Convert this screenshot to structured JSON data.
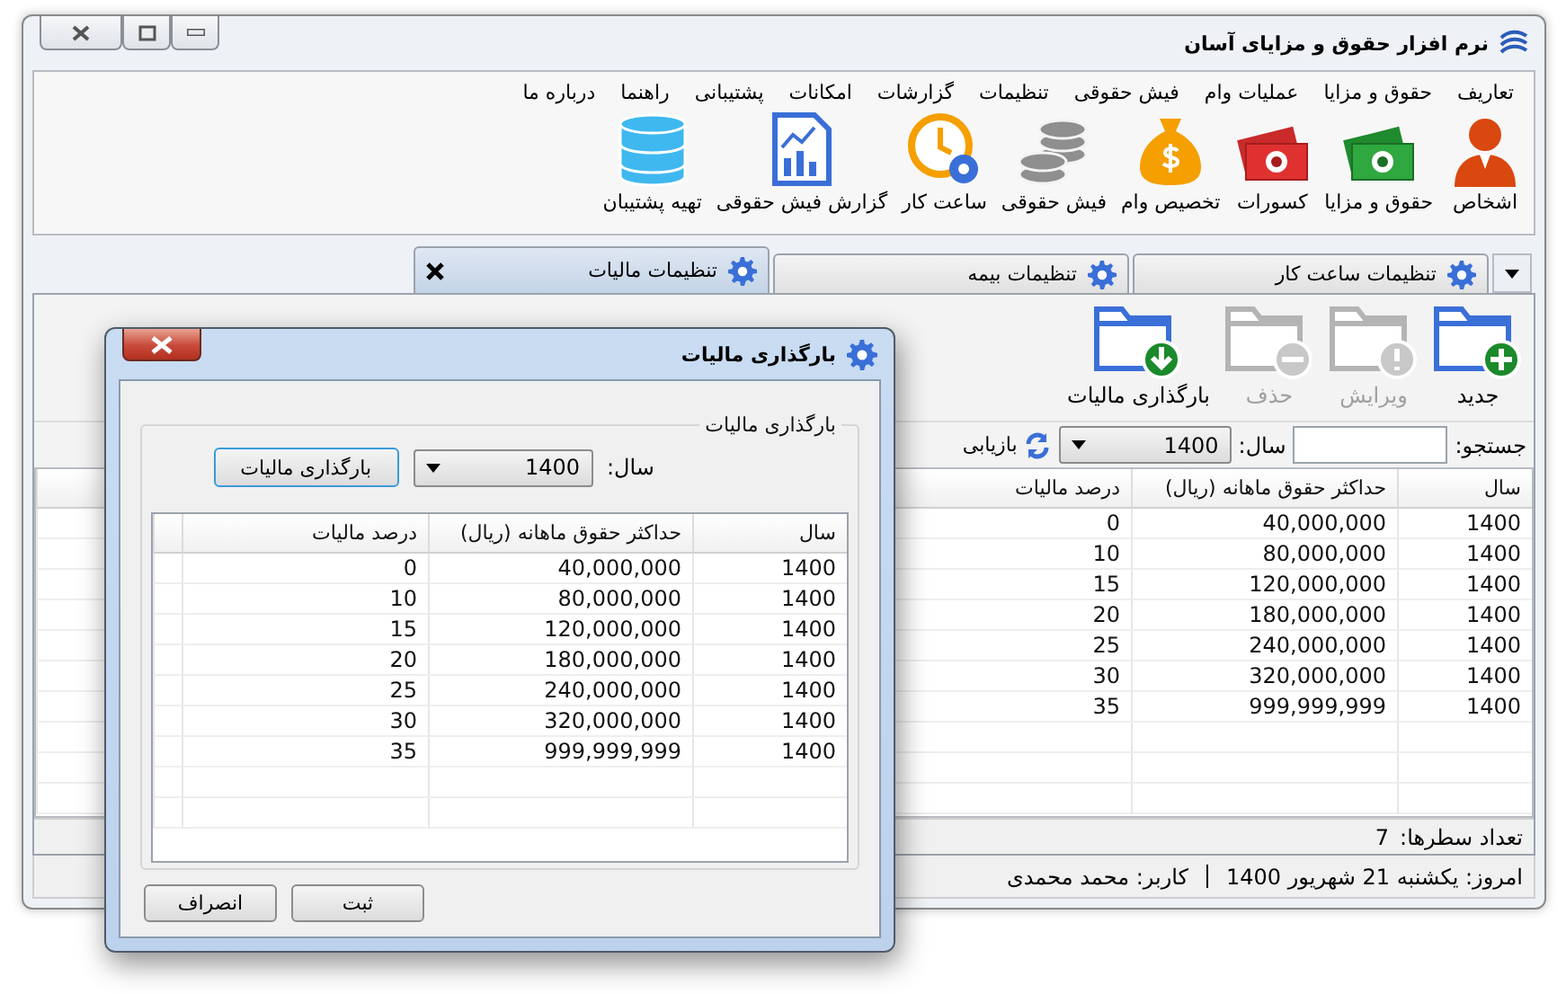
{
  "window": {
    "title": "نرم افزار حقوق و مزایای آسان"
  },
  "menu": [
    "تعاریف",
    "حقوق و مزایا",
    "عملیات وام",
    "فیش حقوقی",
    "تنظیمات",
    "گزارشات",
    "امکانات",
    "پشتیبانی",
    "راهنما",
    "درباره ما"
  ],
  "toolbar": [
    {
      "label": "اشخاص",
      "kind": "person"
    },
    {
      "label": "حقوق و مزایا",
      "kind": "money"
    },
    {
      "label": "کسورات",
      "kind": "deduction"
    },
    {
      "label": "تخصیص وام",
      "kind": "bag"
    },
    {
      "label": "فیش حقوقی",
      "kind": "coins"
    },
    {
      "label": "ساعت کار",
      "kind": "clock"
    },
    {
      "label": "گزارش فیش حقوقی",
      "kind": "report"
    },
    {
      "label": "تهیه پشتیبان",
      "kind": "database"
    }
  ],
  "tabs": [
    {
      "label": "تنظیمات ساعت کار",
      "selected": false
    },
    {
      "label": "تنظیمات بیمه",
      "selected": false
    },
    {
      "label": "تنظیمات مالیات",
      "selected": true
    }
  ],
  "actions": [
    {
      "label": "جدید",
      "kind": "add",
      "disabled": false
    },
    {
      "label": "ویرایش",
      "kind": "edit",
      "disabled": true
    },
    {
      "label": "حذف",
      "kind": "delete",
      "disabled": true
    },
    {
      "label": "بارگذاری مالیات",
      "kind": "load",
      "disabled": false
    }
  ],
  "search": {
    "label": "جستجو:",
    "year_label": "سال:",
    "year": "1400",
    "refresh": "بازیابی"
  },
  "table": {
    "columns": [
      "سال",
      "حداکثر حقوق ماهانه (ریال)",
      "درصد مالیات"
    ],
    "rows": [
      [
        "1400",
        "40,000,000",
        "0"
      ],
      [
        "1400",
        "80,000,000",
        "10"
      ],
      [
        "1400",
        "120,000,000",
        "15"
      ],
      [
        "1400",
        "180,000,000",
        "20"
      ],
      [
        "1400",
        "240,000,000",
        "25"
      ],
      [
        "1400",
        "320,000,000",
        "30"
      ],
      [
        "1400",
        "999,999,999",
        "35"
      ]
    ]
  },
  "row_count": {
    "label": "تعداد سطرها:",
    "value": "7"
  },
  "status_bar": {
    "date": "امروز: یکشنبه 21 شهریور 1400",
    "user": "کاربر: محمد محمدی"
  },
  "dialog": {
    "title": "بارگذاری مالیات",
    "group_title": "بارگذاری مالیات",
    "year_label": "سال:",
    "year": "1400",
    "load_button": "بارگذاری مالیات",
    "table": {
      "columns": [
        "سال",
        "حداکثر حقوق ماهانه (ریال)",
        "درصد مالیات"
      ],
      "rows": [
        [
          "1400",
          "40,000,000",
          "0"
        ],
        [
          "1400",
          "80,000,000",
          "10"
        ],
        [
          "1400",
          "120,000,000",
          "15"
        ],
        [
          "1400",
          "180,000,000",
          "20"
        ],
        [
          "1400",
          "240,000,000",
          "25"
        ],
        [
          "1400",
          "320,000,000",
          "30"
        ],
        [
          "1400",
          "999,999,999",
          "35"
        ]
      ]
    },
    "buttons": [
      "ثبت",
      "انصراف"
    ]
  }
}
